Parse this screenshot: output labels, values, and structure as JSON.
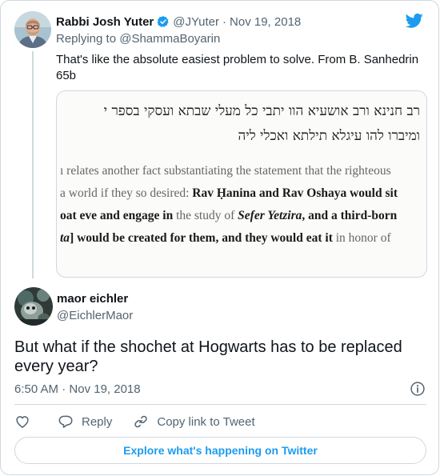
{
  "tweet1": {
    "author_name": "Rabbi Josh Yuter",
    "handle": "@JYuter",
    "separator": "·",
    "date": "Nov 19, 2018",
    "replying_to": "Replying to @ShammaBoyarin",
    "text": "That's like the absolute easiest problem to solve. From B. Sanhedrin 65b",
    "media": {
      "hebrew_line1": "רב חנינא ורב אושעיא הוו יתבי כל מעלי שבתא ועסקי בספר י",
      "hebrew_line2": "ומיברו להו עיגלא תילתא ואכלי ליה",
      "english_lines": [
        {
          "pre": "ı relates another fact substantiating the statement that the righteous",
          "bold": "",
          "mid": "",
          "italic": "",
          "post": "",
          "bold2": ""
        },
        {
          "pre": "a world if they so desired: ",
          "bold": "Rav Ḥanina and Rav Oshaya would sit",
          "mid": "",
          "italic": "",
          "post": "",
          "bold2": ""
        },
        {
          "pre": "",
          "bold": "oat eve and engage in",
          "mid": " the study of ",
          "italic": "Sefer Yetzira",
          "post": "",
          "bold2": ", and a third-born"
        },
        {
          "pre": "",
          "bold": "",
          "mid": "",
          "italic": "ta",
          "post": "] ",
          "bold2": "would be created for them, and they would eat it"
        }
      ],
      "english_line4_tail": " in honor of"
    }
  },
  "tweet2": {
    "author_name": "maor eichler",
    "handle": "@EichlerMaor",
    "text": "But what if the shochet at Hogwarts has to be replaced every year?",
    "time": "6:50 AM",
    "separator": "·",
    "date": "Nov 19, 2018"
  },
  "actions": {
    "reply_label": "Reply",
    "copy_label": "Copy link to Tweet"
  },
  "explore_label": "Explore what's happening on Twitter",
  "colors": {
    "accent": "#1d9bf0",
    "secondary_text": "#536471",
    "border": "#cfd9de"
  },
  "icons": [
    "twitter-bird-icon",
    "verified-badge-icon",
    "heart-icon",
    "reply-bubble-icon",
    "link-icon",
    "info-icon"
  ]
}
